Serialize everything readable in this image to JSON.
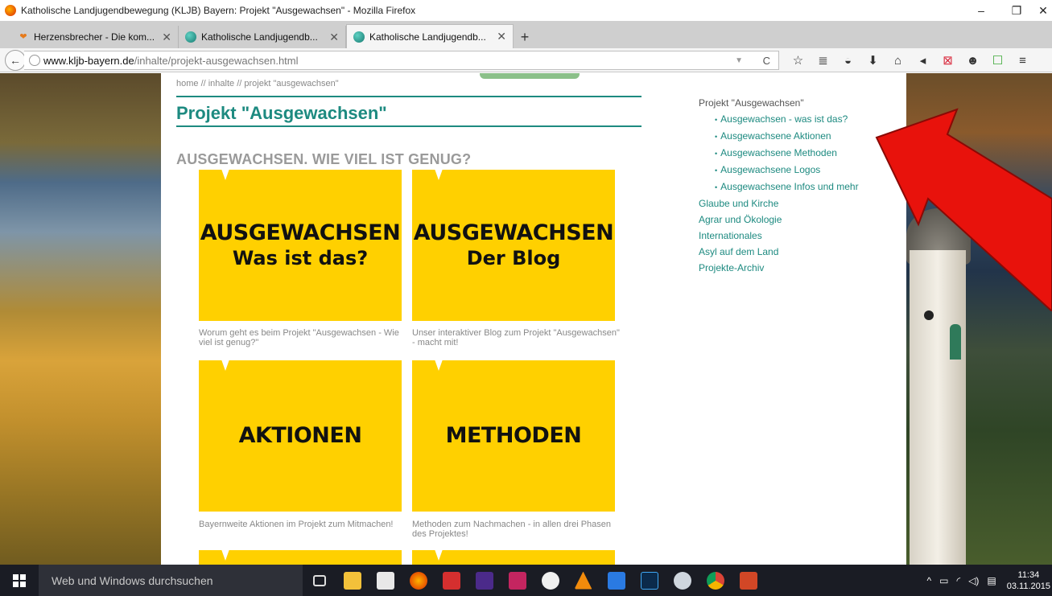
{
  "window": {
    "title": "Katholische Landjugendbewegung (KLJB) Bayern: Projekt \"Ausgewachsen\" - Mozilla Firefox",
    "minimize": "–",
    "maximize": "❐",
    "close": "✕"
  },
  "tabs": [
    {
      "label": "Herzensbrecher - Die kom...",
      "close": "✕",
      "icon": "heart-icon"
    },
    {
      "label": "Katholische Landjugendb...",
      "close": "✕",
      "icon": "globe-icon"
    },
    {
      "label": "Katholische Landjugendb...",
      "close": "✕",
      "icon": "globe-icon"
    }
  ],
  "new_tab": "+",
  "nav": {
    "back": "←",
    "url_host": "www.kljb-bayern.de",
    "url_path": "/inhalte/projekt-ausgewachsen.html",
    "dropdown": "▼",
    "reload": "C",
    "toolbar_icons": [
      "☆",
      "≣",
      "◒",
      "⬇",
      "⌂",
      "◂",
      "⊠",
      "☻",
      "☐",
      "≡"
    ]
  },
  "page": {
    "breadcrumb": "home // inhalte // projekt \"ausgewachsen\"",
    "title": "Projekt \"Ausgewachsen\"",
    "section_heading": "AUSGEWACHSEN. WIE VIEL IST GENUG?",
    "tiles": [
      {
        "line1": "AUSGEWACHSEN",
        "line2": "Was ist das?",
        "caption": "Worum geht es beim Projekt \"Ausgewachsen - Wie viel ist genug?\""
      },
      {
        "line1": "AUSGEWACHSEN",
        "line2": "Der Blog",
        "caption": "Unser interaktiver Blog zum Projekt \"Ausgewachsen\" - macht mit!"
      },
      {
        "line1": "AKTIONEN",
        "line2": "",
        "caption": "Bayernweite Aktionen im Projekt zum Mitmachen!"
      },
      {
        "line1": "METHODEN",
        "line2": "",
        "caption": "Methoden zum Nachmachen - in allen drei Phasen des Projektes!"
      }
    ],
    "sidenav": {
      "parent": "Projekt \"Ausgewachsen\"",
      "subitems": [
        "Ausgewachsen - was ist das?",
        "Ausgewachsene Aktionen",
        "Ausgewachsene Methoden",
        "Ausgewachsene Logos",
        "Ausgewachsene Infos und mehr"
      ],
      "top_items": [
        "Glaube und Kirche",
        "Agrar und Ökologie",
        "Internationales",
        "Asyl auf dem Land",
        "Projekte-Archiv"
      ]
    }
  },
  "taskbar": {
    "search_placeholder": "Web und Windows durchsuchen",
    "time": "11:34",
    "date": "03.11.2015",
    "tray_icons": [
      "^",
      "▭",
      "◜",
      "◁)",
      "▤"
    ]
  },
  "colors": {
    "accent": "#1d8a80",
    "tile": "#ffd000",
    "arrow": "#e8120c"
  }
}
